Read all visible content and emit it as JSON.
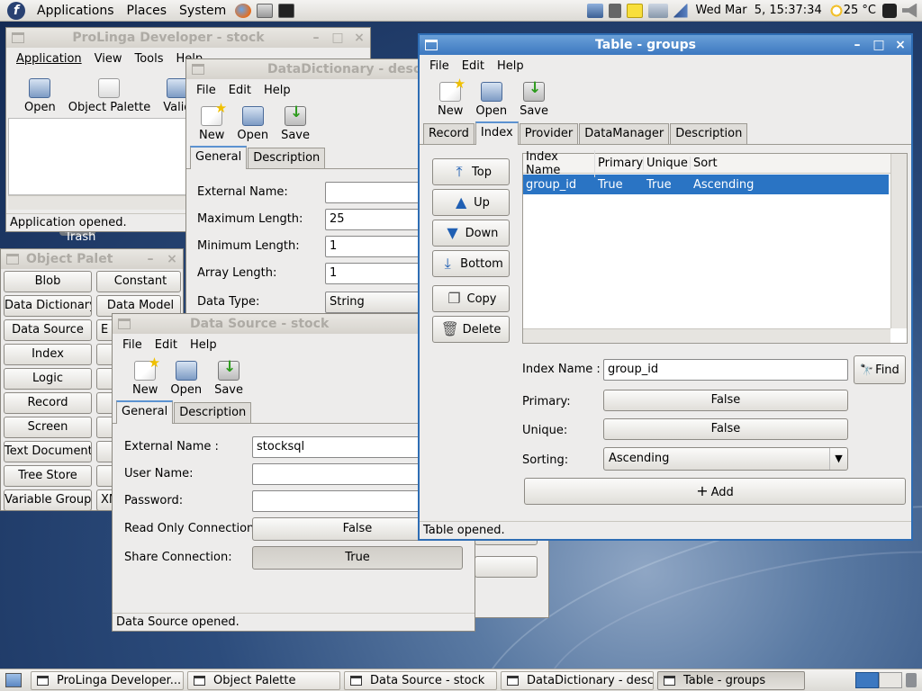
{
  "top_panel": {
    "menus": [
      "Applications",
      "Places",
      "System"
    ],
    "clock": "Wed Mar  5, 15:37:34",
    "weather": "25 °C"
  },
  "desktop": {
    "trash_label": "Trash"
  },
  "windows": {
    "prolinga": {
      "title": "ProLinga Developer - stock",
      "menu": [
        "Application",
        "View",
        "Tools",
        "Help"
      ],
      "toolbar": [
        "Open",
        "Object Palette",
        "Valid"
      ],
      "status": "Application opened."
    },
    "palette": {
      "title": "Object Palet",
      "col1": [
        "Blob",
        "Data Dictionary",
        "Data Source",
        "Index",
        "Logic",
        "Record",
        "Screen",
        "Text Document",
        "Tree Store",
        "Variable Group"
      ],
      "col2": [
        "Constant",
        "Data Model",
        "E",
        "",
        "",
        "",
        "",
        "",
        "",
        "XM"
      ]
    },
    "datadict": {
      "title": "DataDictionary - desc",
      "menu": [
        "File",
        "Edit",
        "Help"
      ],
      "toolbar": [
        "New",
        "Open",
        "Save"
      ],
      "tabs": [
        "General",
        "Description"
      ],
      "fields": [
        {
          "label": "External Name:",
          "value": ""
        },
        {
          "label": "Maximum Length:",
          "value": "25"
        },
        {
          "label": "Minimum Length:",
          "value": "1"
        },
        {
          "label": "Array Length:",
          "value": "1"
        },
        {
          "label": "Data Type:",
          "value": "String"
        }
      ]
    },
    "datasource": {
      "title": "Data Source - stock",
      "menu": [
        "File",
        "Edit",
        "Help"
      ],
      "toolbar": [
        "New",
        "Open",
        "Save"
      ],
      "tabs": [
        "General",
        "Description"
      ],
      "fields": [
        {
          "label": "External Name :",
          "value": "stocksql"
        },
        {
          "label": "User Name:",
          "value": ""
        },
        {
          "label": "Password:",
          "value": ""
        },
        {
          "label": "Read Only Connection:",
          "value": "False"
        },
        {
          "label": "Share Connection:",
          "value": "True"
        }
      ],
      "status": "Data Source opened."
    },
    "table": {
      "title": "Table - groups",
      "menu": [
        "File",
        "Edit",
        "Help"
      ],
      "toolbar": [
        "New",
        "Open",
        "Save"
      ],
      "tabs": [
        "Record",
        "Index",
        "Provider",
        "DataManager",
        "Description"
      ],
      "nav_buttons": [
        "Top",
        "Up",
        "Down",
        "Bottom",
        "Copy",
        "Delete"
      ],
      "columns": [
        "Index Name",
        "Primary",
        "Unique",
        "Sort"
      ],
      "rows": [
        [
          "group_id",
          "True",
          "True",
          "Ascending"
        ]
      ],
      "form": {
        "index_name_label": "Index Name :",
        "index_name_value": "group_id",
        "find_label": "Find",
        "primary_label": "Primary:",
        "primary_value": "False",
        "unique_label": "Unique:",
        "unique_value": "False",
        "sorting_label": "Sorting:",
        "sorting_value": "Ascending",
        "add_label": "Add"
      },
      "status": "Table opened."
    }
  },
  "taskbar": [
    {
      "label": "ProLinga Developer...",
      "active": false
    },
    {
      "label": "Object Palette",
      "active": false
    },
    {
      "label": "Data Source - stock",
      "active": false
    },
    {
      "label": "DataDictionary - desc",
      "active": false
    },
    {
      "label": "Table - groups",
      "active": true
    }
  ],
  "colors": {
    "selection": "#2a74c4",
    "active_title": "#3c78c0",
    "panel": "#dcdad5"
  }
}
